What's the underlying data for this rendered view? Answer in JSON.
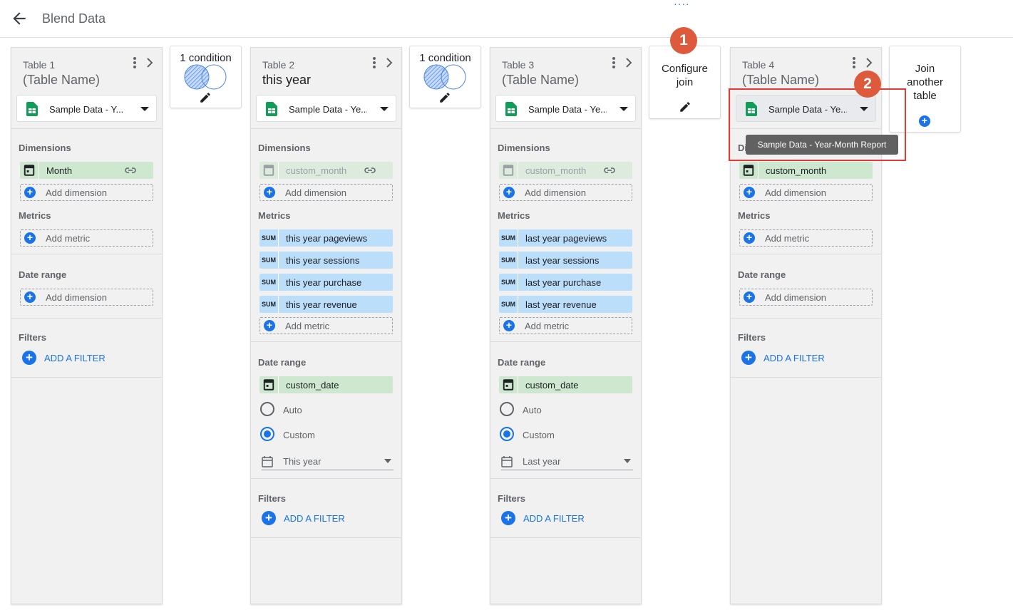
{
  "header": {
    "title": "Blend Data",
    "drag_handle": "····"
  },
  "colors": {
    "accent": "#1a73e8",
    "dimension_chip": "#cde8cf",
    "metric_chip": "#bbdefb",
    "badge": "#dd5a3c",
    "highlight_box": "#e53935"
  },
  "tables": [
    {
      "label": "Table 1",
      "name": "(Table Name)",
      "datasource": "Sample Data - Y...",
      "dimensions_heading": "Dimensions",
      "dimension": "Month",
      "add_dimension": "Add dimension",
      "metrics_heading": "Metrics",
      "add_metric": "Add metric",
      "date_range_heading": "Date range",
      "date_add": "Add dimension",
      "filters_heading": "Filters",
      "add_filter": "ADD A FILTER"
    },
    {
      "label": "Table 2",
      "name": "this year",
      "datasource": "Sample Data - Ye...",
      "dimensions_heading": "Dimensions",
      "dimension": "custom_month",
      "add_dimension": "Add dimension",
      "metrics_heading": "Metrics",
      "metrics": [
        {
          "agg": "SUM",
          "name": "this year pageviews"
        },
        {
          "agg": "SUM",
          "name": "this year sessions"
        },
        {
          "agg": "SUM",
          "name": "this year purchase"
        },
        {
          "agg": "SUM",
          "name": "this year revenue"
        }
      ],
      "add_metric": "Add metric",
      "date_range_heading": "Date range",
      "date_field": "custom_date",
      "auto_label": "Auto",
      "custom_label": "Custom",
      "period": "This year",
      "filters_heading": "Filters",
      "add_filter": "ADD A FILTER"
    },
    {
      "label": "Table 3",
      "name": "(Table Name)",
      "datasource": "Sample Data - Ye...",
      "dimensions_heading": "Dimensions",
      "dimension": "custom_month",
      "add_dimension": "Add dimension",
      "metrics_heading": "Metrics",
      "metrics": [
        {
          "agg": "SUM",
          "name": "last year pageviews"
        },
        {
          "agg": "SUM",
          "name": "last year sessions"
        },
        {
          "agg": "SUM",
          "name": "last year purchase"
        },
        {
          "agg": "SUM",
          "name": "last year revenue"
        }
      ],
      "add_metric": "Add metric",
      "date_range_heading": "Date range",
      "date_field": "custom_date",
      "auto_label": "Auto",
      "custom_label": "Custom",
      "period": "Last year",
      "filters_heading": "Filters",
      "add_filter": "ADD A FILTER"
    },
    {
      "label": "Table 4",
      "name": "(Table Name)",
      "datasource": "Sample Data - Ye...",
      "dimensions_heading": "Di",
      "dimension": "custom_month",
      "add_dimension": "Add dimension",
      "metrics_heading": "Metrics",
      "add_metric": "Add metric",
      "date_range_heading": "Date range",
      "date_add": "Add dimension",
      "filters_heading": "Filters",
      "add_filter": "ADD A FILTER"
    }
  ],
  "joins": [
    {
      "label": "1 condition"
    },
    {
      "label": "1 condition"
    }
  ],
  "configure_join": {
    "line1": "Configure",
    "line2": "join"
  },
  "join_another": {
    "line1": "Join",
    "line2": "another",
    "line3": "table"
  },
  "tooltip": "Sample Data - Year-Month Report",
  "badges": [
    "1",
    "2"
  ]
}
